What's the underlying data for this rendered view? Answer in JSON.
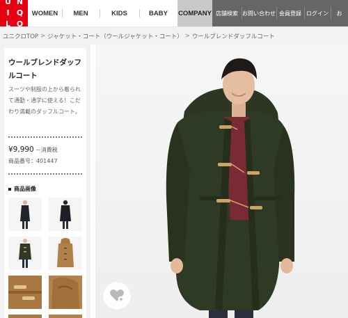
{
  "brand": {
    "logo_letters": [
      "U",
      "N",
      "I",
      "Q",
      "L",
      "O"
    ],
    "accent": "#e60012"
  },
  "nav": {
    "items": [
      "WOMEN",
      "MEN",
      "KIDS",
      "BABY"
    ],
    "company": "COMPANY",
    "utility": [
      "店舗検索",
      "お問い合わせ",
      "会員登録",
      "ログイン",
      "お"
    ]
  },
  "breadcrumb": {
    "items": [
      "ユニクロTOP",
      "ジャケット・コート（ウールジャケット・コート）",
      "ウールブレンドダッフルコート"
    ],
    "separator": ">"
  },
  "product": {
    "name": "ウールブレンドダッフルコート",
    "description": "スーツや制服の上から着られて通勤・通学に使える！こだわり満載のダッフルコート。",
    "price": "¥9,990",
    "price_suffix": "－消費税",
    "number": "商品番号：401447"
  },
  "gallery": {
    "title": "商品画像"
  },
  "colors": {
    "coat": "#2f3a24",
    "toggle": "#c9a463",
    "sweater": "#7a2a34"
  }
}
